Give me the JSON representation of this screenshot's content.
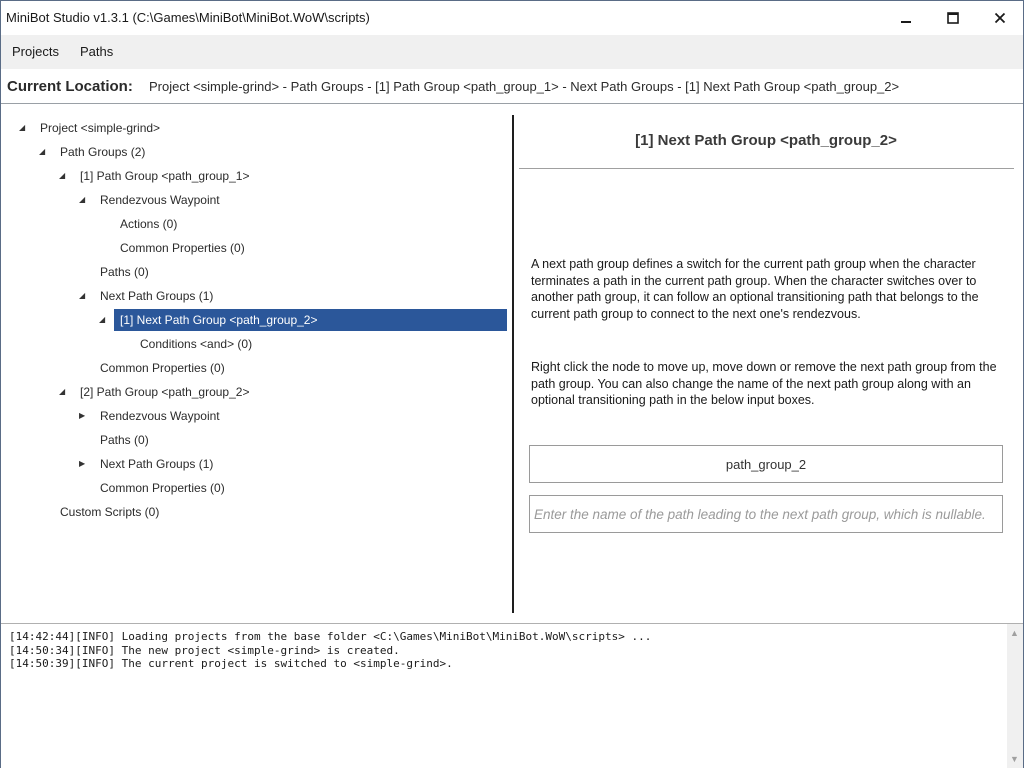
{
  "window": {
    "title": "MiniBot Studio v1.3.1 (C:\\Games\\MiniBot\\MiniBot.WoW\\scripts)",
    "minimize_icon": "minimize-icon",
    "maximize_icon": "maximize-icon",
    "close_icon": "close-icon"
  },
  "menu": {
    "projects": "Projects",
    "paths": "Paths"
  },
  "location": {
    "label": "Current Location:",
    "path": "Project <simple-grind> - Path Groups - [1] Path Group <path_group_1> - Next Path Groups - [1] Next Path Group <path_group_2>"
  },
  "tree": {
    "items": [
      {
        "label": "Project <simple-grind>",
        "expander": "expanded"
      },
      {
        "label": "Path Groups (2)",
        "expander": "expanded"
      },
      {
        "label": "[1] Path Group <path_group_1>",
        "expander": "expanded"
      },
      {
        "label": "Rendezvous Waypoint",
        "expander": "expanded"
      },
      {
        "label": "Actions (0)",
        "expander": "none"
      },
      {
        "label": "Common Properties (0)",
        "expander": "none"
      },
      {
        "label": "Paths (0)",
        "expander": "none"
      },
      {
        "label": "Next Path Groups (1)",
        "expander": "expanded"
      },
      {
        "label": "[1] Next Path Group <path_group_2>",
        "expander": "expanded",
        "selected": true
      },
      {
        "label": "Conditions <and> (0)",
        "expander": "none"
      },
      {
        "label": "Common Properties (0)",
        "expander": "none"
      },
      {
        "label": "[2] Path Group <path_group_2>",
        "expander": "expanded"
      },
      {
        "label": "Rendezvous Waypoint",
        "expander": "collapsed"
      },
      {
        "label": "Paths (0)",
        "expander": "none"
      },
      {
        "label": "Next Path Groups (1)",
        "expander": "collapsed"
      },
      {
        "label": "Common Properties (0)",
        "expander": "none"
      },
      {
        "label": "Custom Scripts (0)",
        "expander": "none"
      }
    ]
  },
  "detail": {
    "title": "[1] Next Path Group <path_group_2>",
    "description_1": "A next path group defines a switch for the current path group when the character terminates a path in the current path group. When the character switches over to another path group, it can follow an optional transitioning path that belongs to the current path group to connect to the next one's rendezvous.",
    "description_2": "Right click the node to move up, move down or remove the next path group from the path group. You can also change the name of the next path group along with an optional transitioning path in the below input boxes.",
    "next_group_name_value": "path_group_2",
    "transition_path_placeholder": "Enter the name of the path leading to the next path group, which is nullable."
  },
  "log": {
    "lines": [
      "[14:42:44][INFO] Loading projects from the base folder <C:\\Games\\MiniBot\\MiniBot.WoW\\scripts> ...",
      "[14:50:34][INFO] The new project <simple-grind> is created.",
      "[14:50:39][INFO] The current project is switched to <simple-grind>."
    ]
  }
}
